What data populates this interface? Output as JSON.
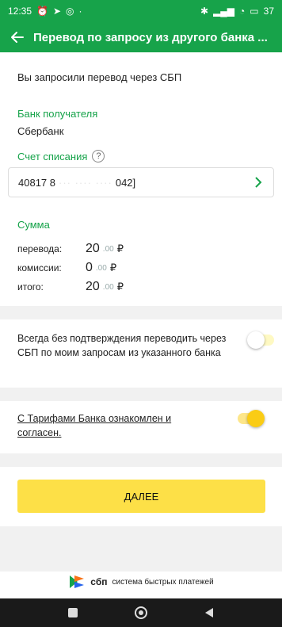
{
  "status_bar": {
    "time": "12:35",
    "battery": "37"
  },
  "header": {
    "title": "Перевод по запросу из другого банка ..."
  },
  "requested_text": "Вы запросили перевод через СБП",
  "bank": {
    "label": "Банк получателя",
    "value": "Сбербанк"
  },
  "account": {
    "label": "Счет списания",
    "help": "?",
    "start": "40817 8",
    "mask": "··· ···· ····",
    "end": "042]"
  },
  "sum": {
    "label": "Сумма",
    "rows": [
      {
        "name": "перевода:",
        "int": "20",
        "dec": ".00",
        "currency": "₽"
      },
      {
        "name": "комиссии:",
        "int": "0",
        "dec": ".00",
        "currency": "₽"
      },
      {
        "name": "итого:",
        "int": "20",
        "dec": ".00",
        "currency": "₽"
      }
    ]
  },
  "confirm_toggle": {
    "text": "Всегда без подтверждения переводить через СБП по моим запросам из указанного банка",
    "on": false
  },
  "tariffs_toggle": {
    "text": "С Тарифами Банка ознакомлен и согласен.",
    "on": true
  },
  "next_button": "ДАЛЕЕ",
  "sbp": {
    "brand": "сбп",
    "description": "система быстрых платежей"
  },
  "colors": {
    "green": "#17a34a",
    "yellow": "#fde047",
    "toggle_on": "#facc15"
  }
}
